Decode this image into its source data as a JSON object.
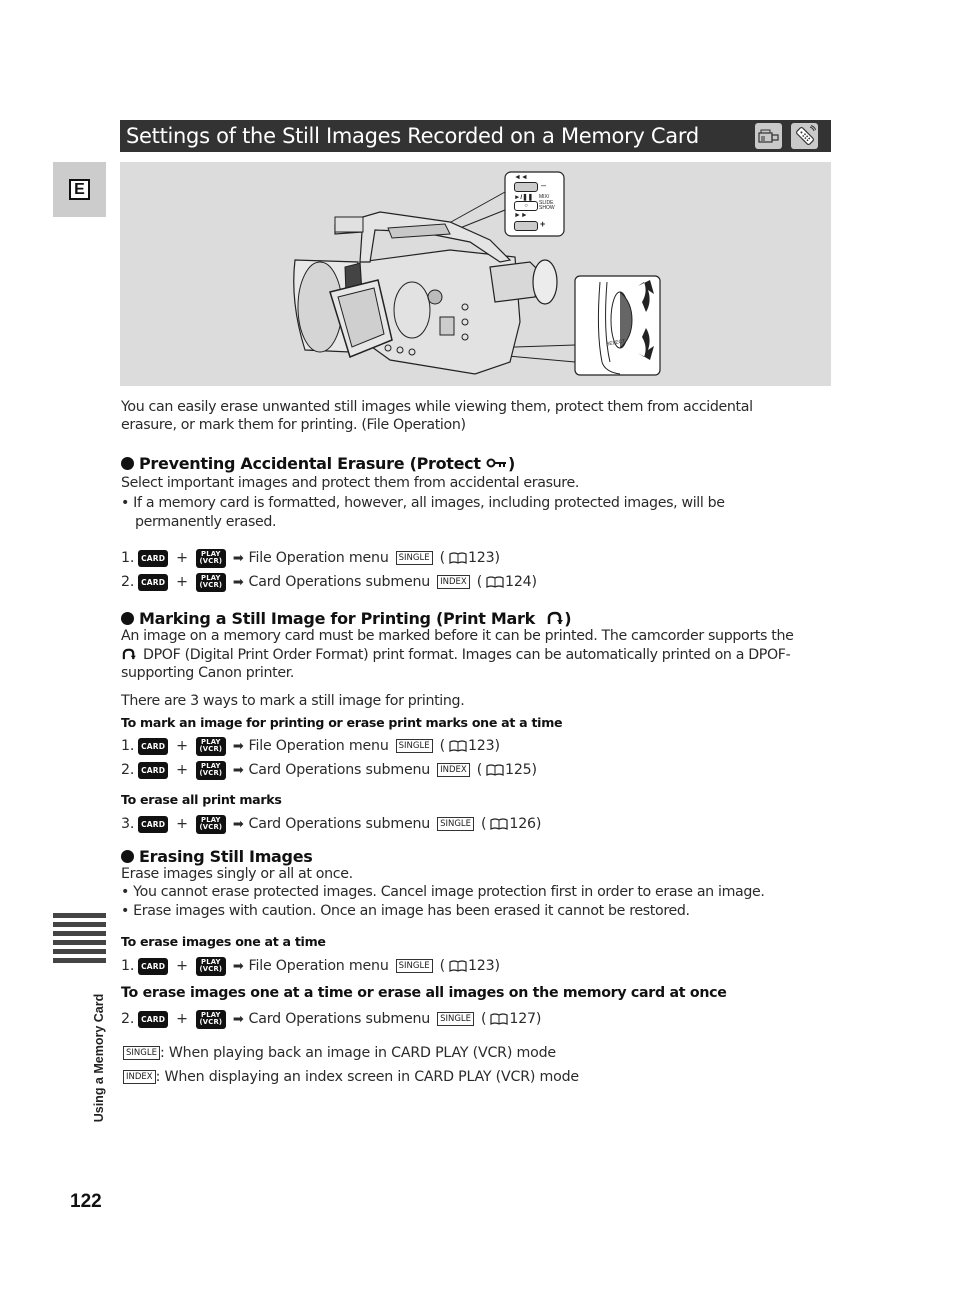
{
  "title": "Settings of the Still Images Recorded on a Memory Card",
  "title_icons": [
    "camcorder-icon",
    "remote-control-icon"
  ],
  "language_tab": "E",
  "figure": {
    "button_panel": {
      "rewind_label": "◄◄",
      "rewind_side": "–",
      "play_pause_label": "►/❚❚",
      "play_pause_side": [
        "MIX/",
        "SLIDE",
        "SHOW"
      ],
      "center_button": "○",
      "forward_label": "►►",
      "forward_side": "+"
    },
    "dial_panel": {
      "label": "SELECT"
    }
  },
  "intro": [
    "You can easily erase unwanted still images while viewing them, protect them from accidental",
    "erasure, or mark them for printing. (File Operation)"
  ],
  "sections": {
    "protect": {
      "heading": "Preventing Accidental Erasure (Protect ",
      "heading_end": ")",
      "body": "Select important images and protect them from accidental erasure.",
      "bullet_lines": [
        "• If a memory card is formatted, however, all images, including protected images, will be",
        "permanently erased."
      ],
      "steps": [
        {
          "num": "1.",
          "target": "File Operation menu",
          "mode": "SINGLE",
          "page": "123"
        },
        {
          "num": "2.",
          "target": "Card Operations submenu",
          "mode": "INDEX",
          "page": "124"
        }
      ]
    },
    "print_mark": {
      "heading": "Marking a Still Image for Printing (Print Mark ",
      "heading_end": ")",
      "body_lines": [
        "An image on a memory card must be marked before it can be printed. The camcorder supports the",
        "DPOF (Digital Print Order Format) print format. Images can be automatically printed on a DPOF-",
        "supporting Canon printer."
      ],
      "ways": "There are 3 ways to mark a still image for printing.",
      "sub1": "To mark an image for printing or erase print marks one at a time",
      "steps1": [
        {
          "num": "1.",
          "target": "File Operation menu",
          "mode": "SINGLE",
          "page": "123"
        },
        {
          "num": "2.",
          "target": "Card Operations submenu",
          "mode": "INDEX",
          "page": "125"
        }
      ],
      "sub2": "To erase all print marks",
      "steps2": [
        {
          "num": "3.",
          "target": "Card Operations submenu",
          "mode": "SINGLE",
          "page": "126"
        }
      ]
    },
    "erase": {
      "heading": "Erasing Still Images",
      "body": "Erase images singly or all at once.",
      "bullets": [
        "• You cannot erase protected images. Cancel image protection first in order to erase an image.",
        "• Erase images with caution. Once an image has been erased it cannot be restored."
      ],
      "sub1": "To erase images one at a time",
      "steps1": [
        {
          "num": "1.",
          "target": "File Operation menu",
          "mode": "SINGLE",
          "page": "123"
        }
      ],
      "sub2": "To erase images one at a time or erase all images on the memory card at once",
      "steps2": [
        {
          "num": "2.",
          "target": "Card Operations submenu",
          "mode": "SINGLE",
          "page": "127"
        }
      ]
    }
  },
  "keys": {
    "card": "CARD",
    "play_top": "PLAY",
    "play_bottom": "(VCR)",
    "plus": "+",
    "arrow": "➡"
  },
  "legend": [
    {
      "mode": "SINGLE",
      "text": ": When playing back an image in CARD PLAY (VCR) mode"
    },
    {
      "mode": "INDEX",
      "text": ": When displaying an index screen in CARD PLAY (VCR) mode"
    }
  ],
  "side_label": "Using a Memory Card",
  "page_number": "122"
}
